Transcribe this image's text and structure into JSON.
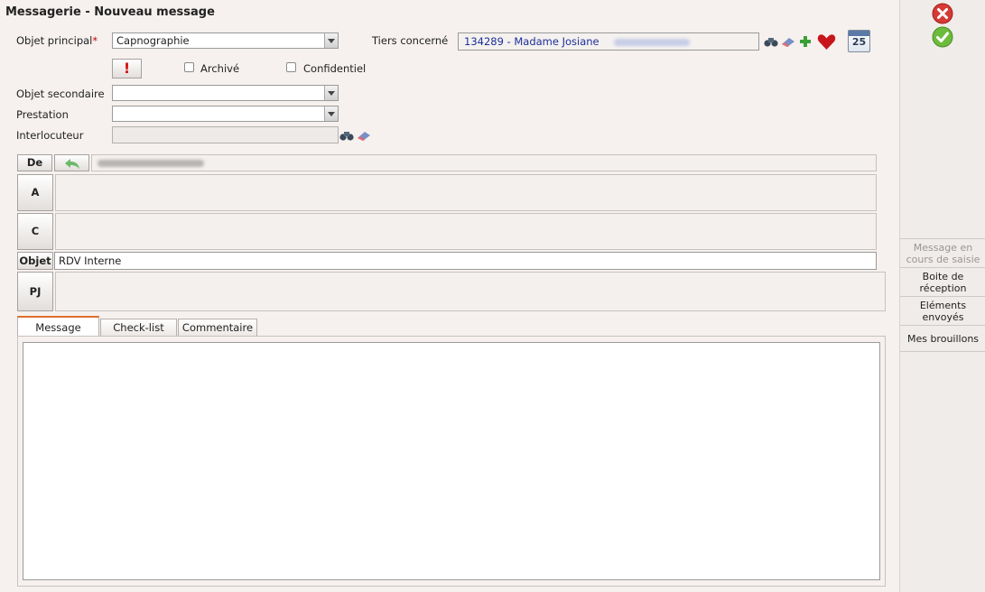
{
  "window": {
    "title": "Messagerie  - Nouveau message"
  },
  "form": {
    "objet_principal_label": "Objet principal",
    "required_mark": "*",
    "objet_principal_value": "Capnographie",
    "tiers_label": "Tiers concerné",
    "tiers_value": "134289 - Madame Josiane",
    "archive_label": "Archivé",
    "confidentiel_label": "Confidentiel",
    "important_symbol": "!",
    "objet_secondaire_label": "Objet secondaire",
    "objet_secondaire_value": "",
    "prestation_label": "Prestation",
    "prestation_value": "",
    "interlocuteur_label": "Interlocuteur",
    "interlocuteur_value": ""
  },
  "message": {
    "de_label": "De",
    "a_label": "A",
    "c_label": "C",
    "objet_label": "Objet",
    "objet_value": "RDV Interne",
    "pj_label": "PJ",
    "body_value": ""
  },
  "tabs": [
    {
      "label": "Message",
      "active": true
    },
    {
      "label": "Check-list",
      "active": false
    },
    {
      "label": "Commentaire",
      "active": false
    }
  ],
  "calendar": {
    "day": "25"
  },
  "sidebar": {
    "items": [
      {
        "label": "Message en cours de saisie",
        "disabled": true
      },
      {
        "label": "Boite de réception",
        "disabled": false
      },
      {
        "label": "Eléments envoyés",
        "disabled": false
      },
      {
        "label": "Mes brouillons",
        "disabled": false
      }
    ]
  },
  "colors": {
    "accent": "#e07030",
    "link_blue": "#1c2f9a",
    "required": "#cc0000",
    "cancel_red": "#d63a35",
    "ok_green": "#6dbb3c"
  },
  "icons": [
    "close-icon",
    "check-icon",
    "binoculars-icon",
    "eraser-icon",
    "plus-icon",
    "heart-icon",
    "calendar-icon",
    "important-icon",
    "reply-icon"
  ]
}
